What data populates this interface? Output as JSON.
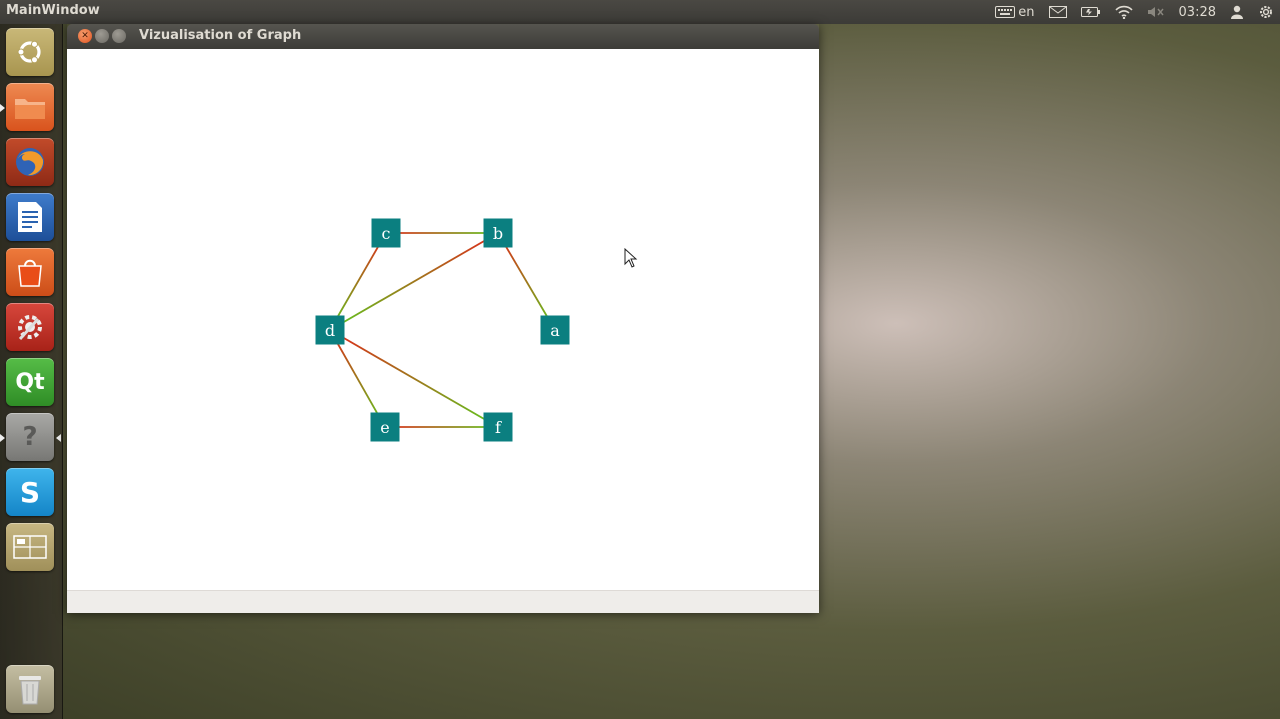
{
  "top_panel": {
    "app_name": "MainWindow",
    "keyboard_layout": "en",
    "time": "03:28"
  },
  "launcher": {
    "items": [
      {
        "name": "dash-home",
        "icon": "ubuntu-logo-icon",
        "color": "#b9a866"
      },
      {
        "name": "files",
        "icon": "folder-icon",
        "color": "#e0622c"
      },
      {
        "name": "firefox",
        "icon": "firefox-icon",
        "color": "#e8762c"
      },
      {
        "name": "libreoffice-writer",
        "icon": "writer-document-icon",
        "color": "#2a63b0"
      },
      {
        "name": "software-center",
        "icon": "shopping-bag-icon",
        "color": "#e0622c"
      },
      {
        "name": "system-settings",
        "icon": "settings-wrench-icon",
        "color": "#cf3a30"
      },
      {
        "name": "qt-creator",
        "icon": "qt-logo-icon",
        "glyph": "Qt",
        "color": "#3ea83a"
      },
      {
        "name": "unknown-app",
        "icon": "question-mark-icon",
        "glyph": "?",
        "color": "#8a8a88"
      },
      {
        "name": "skype",
        "icon": "skype-icon",
        "glyph": "S",
        "color": "#1fa3e0"
      },
      {
        "name": "workspace-switcher",
        "icon": "workspace-switcher-icon",
        "color": "#b8a870"
      },
      {
        "name": "trash",
        "icon": "trash-icon",
        "color": "#b0aa8f"
      }
    ]
  },
  "window": {
    "title": "Vizualisation of Graph"
  },
  "graph": {
    "nodes": [
      {
        "id": "c",
        "label": "c"
      },
      {
        "id": "b",
        "label": "b"
      },
      {
        "id": "a",
        "label": "a"
      },
      {
        "id": "d",
        "label": "d"
      },
      {
        "id": "e",
        "label": "e"
      },
      {
        "id": "f",
        "label": "f"
      }
    ],
    "edges": [
      {
        "from": "c",
        "to": "b"
      },
      {
        "from": "b",
        "to": "a"
      },
      {
        "from": "c",
        "to": "d"
      },
      {
        "from": "b",
        "to": "d"
      },
      {
        "from": "d",
        "to": "e"
      },
      {
        "from": "d",
        "to": "f"
      },
      {
        "from": "e",
        "to": "f"
      }
    ],
    "node_color": "#0b7f80",
    "edge_color_start": "#e0281a",
    "edge_color_end": "#5ec81e"
  }
}
